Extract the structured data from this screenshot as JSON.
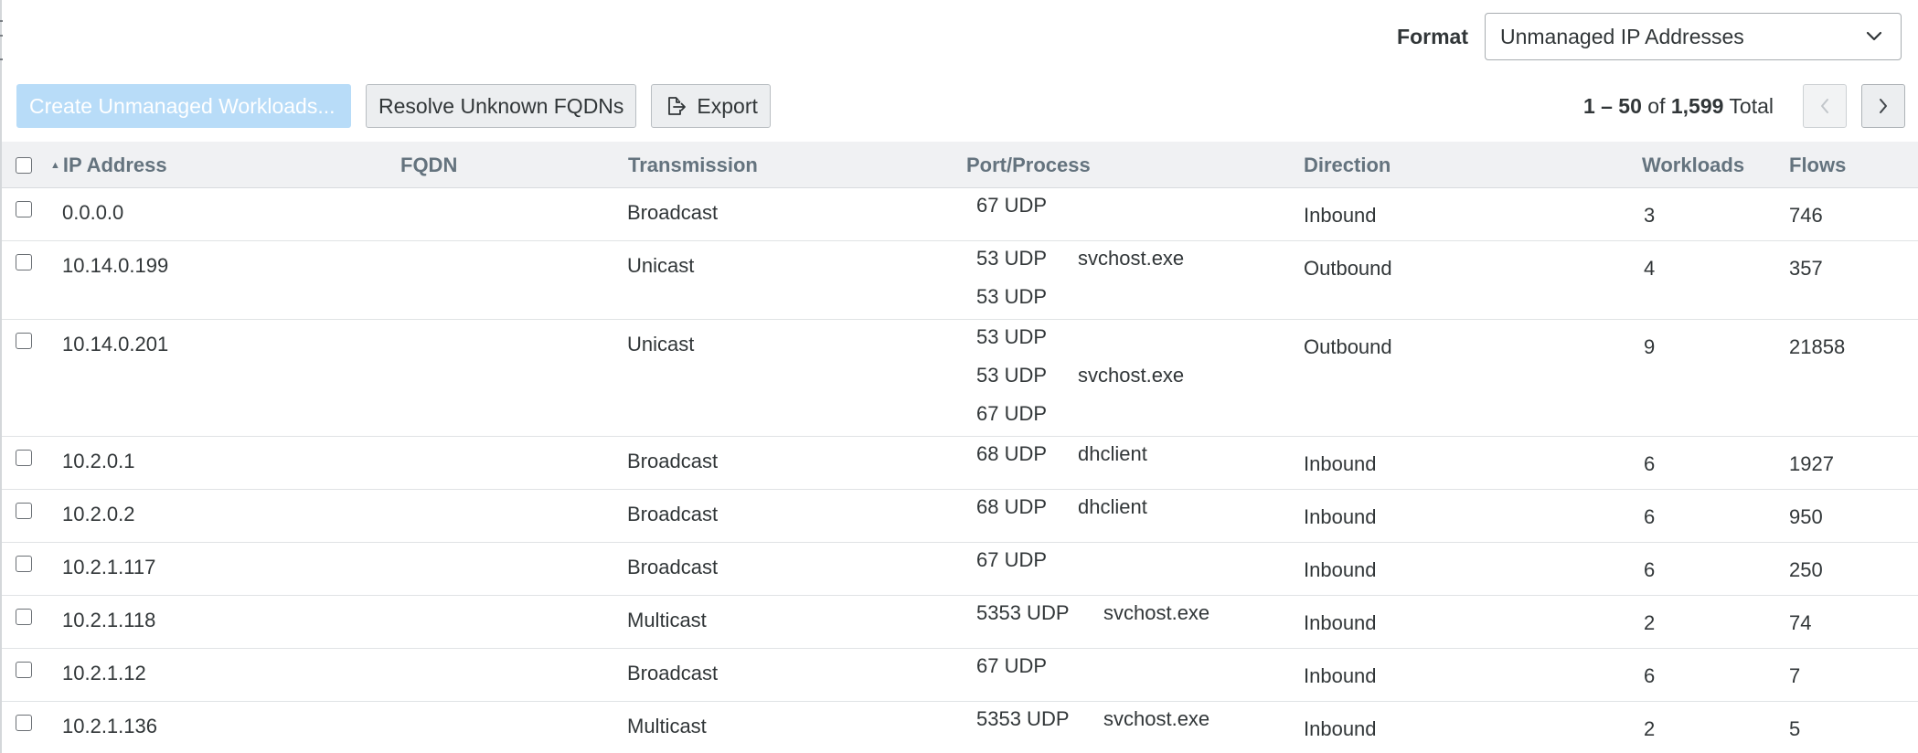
{
  "format": {
    "label": "Format",
    "selected": "Unmanaged IP Addresses"
  },
  "toolbar": {
    "create_label": "Create Unmanaged Workloads...",
    "resolve_label": "Resolve Unknown FQDNs",
    "export_label": "Export"
  },
  "pagination": {
    "range": "1 – 50",
    "of": "of",
    "total": "1,599",
    "total_label": "Total"
  },
  "table": {
    "columns": {
      "ip": "IP Address",
      "fqdn": "FQDN",
      "transmission": "Transmission",
      "port_process": "Port/Process",
      "direction": "Direction",
      "workloads": "Workloads",
      "flows": "Flows"
    },
    "rows": [
      {
        "ip": "0.0.0.0",
        "fqdn": "",
        "transmission": "Broadcast",
        "ports": [
          {
            "port": "67 UDP",
            "process": ""
          }
        ],
        "direction": "Inbound",
        "workloads": "3",
        "flows": "746"
      },
      {
        "ip": "10.14.0.199",
        "fqdn": "",
        "transmission": "Unicast",
        "ports": [
          {
            "port": "53 UDP",
            "process": "svchost.exe"
          },
          {
            "port": "53 UDP",
            "process": ""
          }
        ],
        "direction": "Outbound",
        "workloads": "4",
        "flows": "357"
      },
      {
        "ip": "10.14.0.201",
        "fqdn": "",
        "transmission": "Unicast",
        "ports": [
          {
            "port": "53 UDP",
            "process": ""
          },
          {
            "port": "53 UDP",
            "process": "svchost.exe"
          },
          {
            "port": "67 UDP",
            "process": ""
          }
        ],
        "direction": "Outbound",
        "workloads": "9",
        "flows": "21858"
      },
      {
        "ip": "10.2.0.1",
        "fqdn": "",
        "transmission": "Broadcast",
        "ports": [
          {
            "port": "68 UDP",
            "process": "dhclient"
          }
        ],
        "direction": "Inbound",
        "workloads": "6",
        "flows": "1927"
      },
      {
        "ip": "10.2.0.2",
        "fqdn": "",
        "transmission": "Broadcast",
        "ports": [
          {
            "port": "68 UDP",
            "process": "dhclient"
          }
        ],
        "direction": "Inbound",
        "workloads": "6",
        "flows": "950"
      },
      {
        "ip": "10.2.1.117",
        "fqdn": "",
        "transmission": "Broadcast",
        "ports": [
          {
            "port": "67 UDP",
            "process": ""
          }
        ],
        "direction": "Inbound",
        "workloads": "6",
        "flows": "250"
      },
      {
        "ip": "10.2.1.118",
        "fqdn": "",
        "transmission": "Multicast",
        "ports": [
          {
            "port": "5353 UDP",
            "process": "svchost.exe"
          }
        ],
        "direction": "Inbound",
        "workloads": "2",
        "flows": "74"
      },
      {
        "ip": "10.2.1.12",
        "fqdn": "",
        "transmission": "Broadcast",
        "ports": [
          {
            "port": "67 UDP",
            "process": ""
          }
        ],
        "direction": "Inbound",
        "workloads": "6",
        "flows": "7"
      },
      {
        "ip": "10.2.1.136",
        "fqdn": "",
        "transmission": "Multicast",
        "ports": [
          {
            "port": "5353 UDP",
            "process": "svchost.exe"
          }
        ],
        "direction": "Inbound",
        "workloads": "2",
        "flows": "5"
      }
    ]
  },
  "icons": {
    "chevron": "chevron-down-icon",
    "export": "export-icon",
    "prev": "chevron-left-icon",
    "next": "chevron-right-icon"
  },
  "colors": {
    "primary_disabled": "#b8dcf8",
    "header_text": "#64737e",
    "header_bg": "#f0f1f3"
  }
}
